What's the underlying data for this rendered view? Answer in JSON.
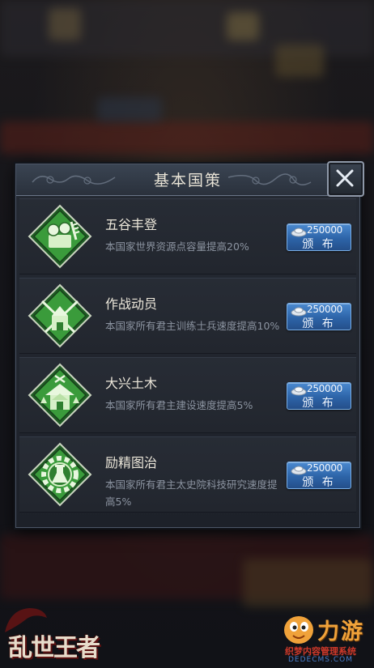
{
  "dialog": {
    "title": "基本国策",
    "close_icon": "close-x-icon"
  },
  "policies": [
    {
      "name": "五谷丰登",
      "description": "本国家世界资源点容量提高20%",
      "icon": "harvest-coins-icon",
      "cost": "250000",
      "button_label": "颁 布"
    },
    {
      "name": "作战动员",
      "description": "本国家所有君主训练士兵速度提高10%",
      "icon": "crossed-swords-castle-icon",
      "cost": "250000",
      "button_label": "颁 布"
    },
    {
      "name": "大兴土木",
      "description": "本国家所有君主建设速度提高5%",
      "icon": "building-tools-icon",
      "cost": "250000",
      "button_label": "颁 布"
    },
    {
      "name": "励精图治",
      "description": "本国家所有君主太史院科技研究速度提高5%",
      "icon": "research-gear-flask-icon",
      "cost": "250000",
      "button_label": "颁 布"
    }
  ],
  "currency_icon": "silver-ingot-icon",
  "branding": {
    "game_logo": "乱世王者",
    "watermark_brand": "力游",
    "watermark_sub": "织梦内容管理系统",
    "watermark_url": "DEDECMS.COM"
  },
  "colors": {
    "accent_button": "#2d64a8",
    "icon_green": "#3f9a3a",
    "panel_bg": "#22262e"
  }
}
